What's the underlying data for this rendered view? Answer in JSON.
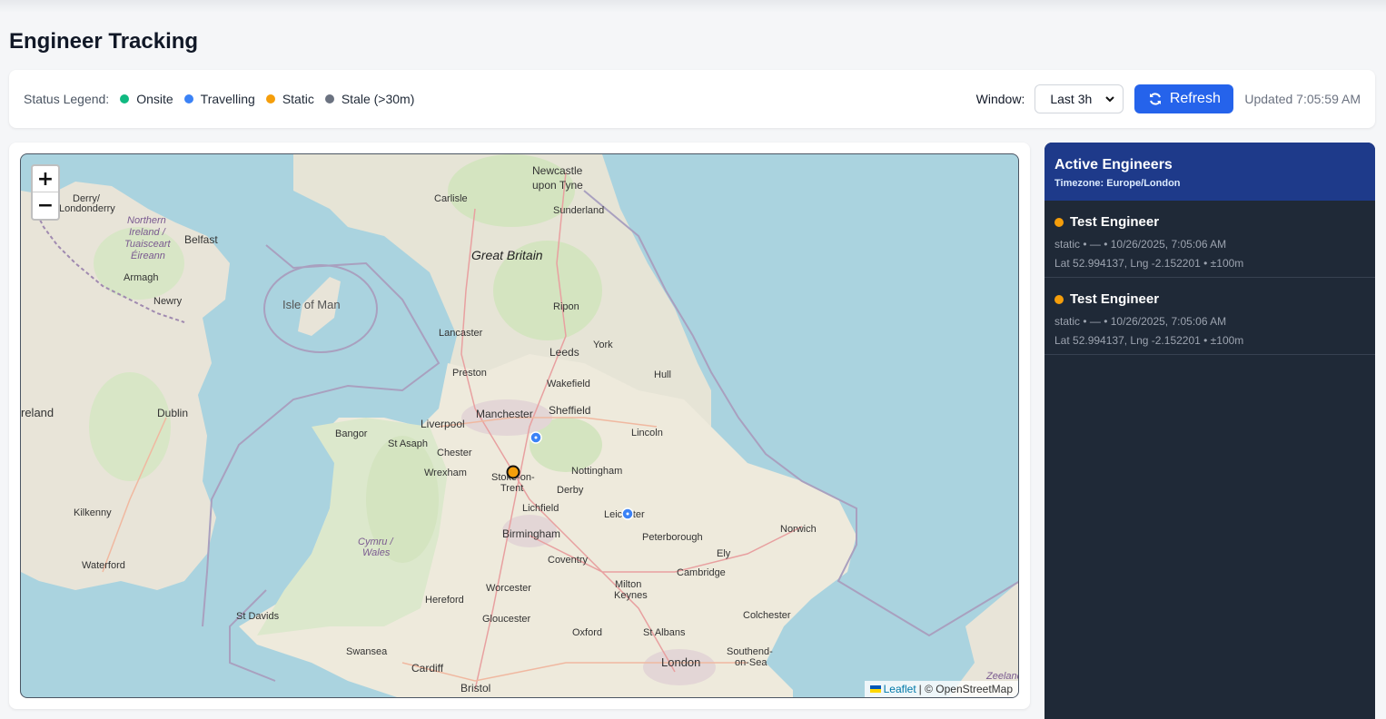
{
  "page": {
    "title": "Engineer Tracking"
  },
  "legend": {
    "title": "Status Legend:",
    "items": [
      {
        "label": "Onsite",
        "color": "#10b981"
      },
      {
        "label": "Travelling",
        "color": "#3b82f6"
      },
      {
        "label": "Static",
        "color": "#f59e0b"
      },
      {
        "label": "Stale (>30m)",
        "color": "#6b7280"
      }
    ]
  },
  "controls": {
    "window_label": "Window:",
    "window_value": "Last 3h",
    "refresh_label": "Refresh",
    "updated_text": "Updated 7:05:59 AM"
  },
  "map": {
    "zoom_in": "+",
    "zoom_out": "−",
    "attribution_link": "Leaflet",
    "attribution_text": "| © OpenStreetMap",
    "labels": {
      "newcastle": "Newcastle",
      "upon_tyne": "upon Tyne",
      "carlisle": "Carlisle",
      "sunderland": "Sunderland",
      "great_britain": "Great Britain",
      "isle_of_man": "Isle of Man",
      "derry": "Derry/",
      "londonderry": "Londonderry",
      "ni1": "Northern",
      "ni2": "Ireland /",
      "ni3": "Tuaisceart",
      "ni4": "Éireann",
      "belfast": "Belfast",
      "armagh": "Armagh",
      "newry": "Newry",
      "ripon": "Ripon",
      "lancaster": "Lancaster",
      "york": "York",
      "leeds": "Leeds",
      "preston": "Preston",
      "hull": "Hull",
      "wakefield": "Wakefield",
      "ireland": "reland",
      "dublin": "Dublin",
      "manchester": "Manchester",
      "sheffield": "Sheffield",
      "liverpool": "Liverpool",
      "bangor": "Bangor",
      "st_asaph": "St Asaph",
      "lincoln": "Lincoln",
      "chester": "Chester",
      "wrexham": "Wrexham",
      "stoke1": "Stoke-on-",
      "stoke2": "Trent",
      "nottingham": "Nottingham",
      "derby": "Derby",
      "lichfield": "Lichfield",
      "leicester": "Leicester",
      "norwich": "Norwich",
      "kilkenny": "Kilkenny",
      "birmingham": "Birmingham",
      "peterborough": "Peterborough",
      "wales1": "Cymru /",
      "wales2": "Wales",
      "ely": "Ely",
      "waterford": "Waterford",
      "coventry": "Coventry",
      "cambridge": "Cambridge",
      "milton": "Milton",
      "keynes": "Keynes",
      "worcester": "Worcester",
      "hereford": "Hereford",
      "colchester": "Colchester",
      "st_davids": "St Davids",
      "gloucester": "Gloucester",
      "oxford": "Oxford",
      "st_albans": "St Albans",
      "southend1": "Southend-",
      "southend2": "on-Sea",
      "swansea": "Swansea",
      "london": "London",
      "cardiff": "Cardiff",
      "zeeland": "Zeeland",
      "bristol": "Bristol"
    }
  },
  "panel": {
    "title": "Active Engineers",
    "timezone": "Timezone: Europe/London",
    "engineers": [
      {
        "name": "Test Engineer",
        "status_color": "#f59e0b",
        "meta": "static • — • 10/26/2025, 7:05:06 AM",
        "coords": "Lat 52.994137, Lng -2.152201 • ±100m"
      },
      {
        "name": "Test Engineer",
        "status_color": "#f59e0b",
        "meta": "static • — • 10/26/2025, 7:05:06 AM",
        "coords": "Lat 52.994137, Lng -2.152201 • ±100m"
      }
    ]
  }
}
